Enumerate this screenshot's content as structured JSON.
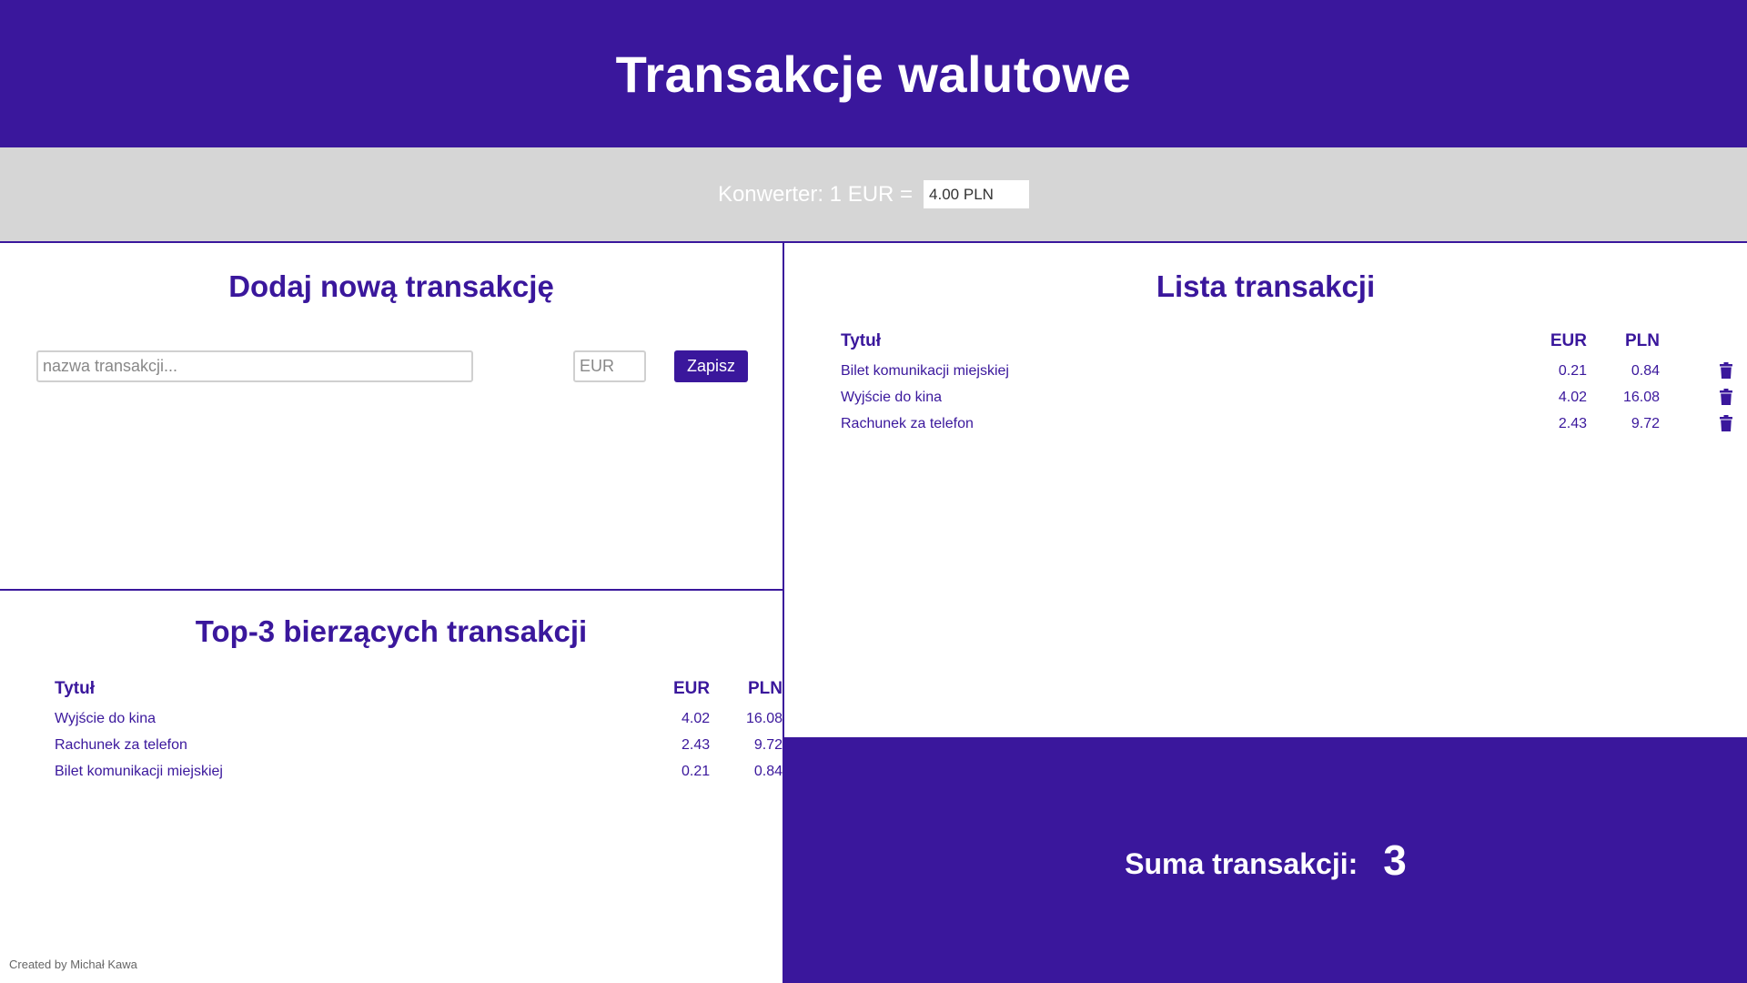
{
  "header": {
    "title": "Transakcje walutowe"
  },
  "converter": {
    "label": "Konwerter: 1 EUR =",
    "value": "4.00 PLN"
  },
  "add_form": {
    "title": "Dodaj nową transakcję",
    "name_placeholder": "nazwa transakcji...",
    "eur_placeholder": "EUR",
    "save_label": "Zapisz"
  },
  "top3": {
    "title": "Top-3 bierzących transakcji",
    "headers": {
      "title": "Tytuł",
      "eur": "EUR",
      "pln": "PLN"
    },
    "rows": [
      {
        "title": "Wyjście do kina",
        "eur": "4.02",
        "pln": "16.08"
      },
      {
        "title": "Rachunek za telefon",
        "eur": "2.43",
        "pln": "9.72"
      },
      {
        "title": "Bilet komunikacji miejskiej",
        "eur": "0.21",
        "pln": "0.84"
      }
    ]
  },
  "list": {
    "title": "Lista transakcji",
    "headers": {
      "title": "Tytuł",
      "eur": "EUR",
      "pln": "PLN"
    },
    "rows": [
      {
        "title": "Bilet komunikacji miejskiej",
        "eur": "0.21",
        "pln": "0.84"
      },
      {
        "title": "Wyjście do kina",
        "eur": "4.02",
        "pln": "16.08"
      },
      {
        "title": "Rachunek za telefon",
        "eur": "2.43",
        "pln": "9.72"
      }
    ],
    "delete_icon": "trash-icon"
  },
  "sum": {
    "label": "Suma transakcji:",
    "value": "3"
  },
  "footer": {
    "text": "Created by Michał Kawa"
  },
  "colors": {
    "accent": "#3a179c",
    "bar": "#d6d6d6"
  }
}
